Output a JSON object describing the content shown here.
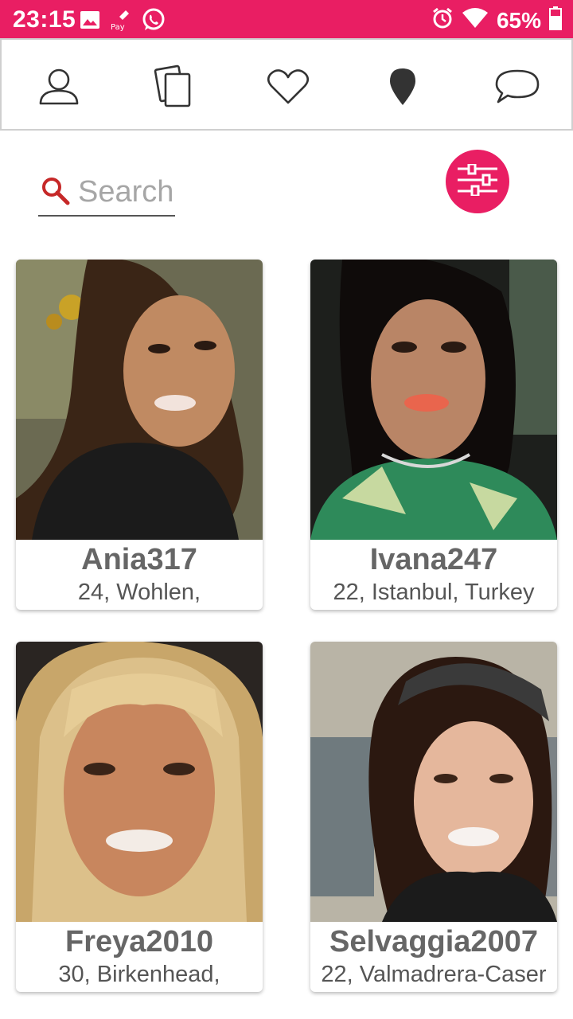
{
  "status_bar": {
    "time": "23:15",
    "battery": "65%",
    "background": "#e91e63",
    "left_icons": [
      "image-icon",
      "pay-icon",
      "whatsapp-icon"
    ],
    "right_icons": [
      "alarm-icon",
      "wifi-icon",
      "battery-icon"
    ]
  },
  "nav": {
    "items": [
      "profile-icon",
      "cards-icon",
      "heart-icon",
      "location-pin-icon",
      "chat-bubble-icon"
    ]
  },
  "search": {
    "placeholder": "Search"
  },
  "accent_color": "#e91e63",
  "profiles": [
    {
      "name": "Ania317",
      "info": "24, Wohlen,"
    },
    {
      "name": "Ivana247",
      "info": "22, Istanbul, Turkey"
    },
    {
      "name": "Freya2010",
      "info": "30, Birkenhead,"
    },
    {
      "name": "Selvaggia2007",
      "info": "22, Valmadrera-Caser"
    }
  ]
}
